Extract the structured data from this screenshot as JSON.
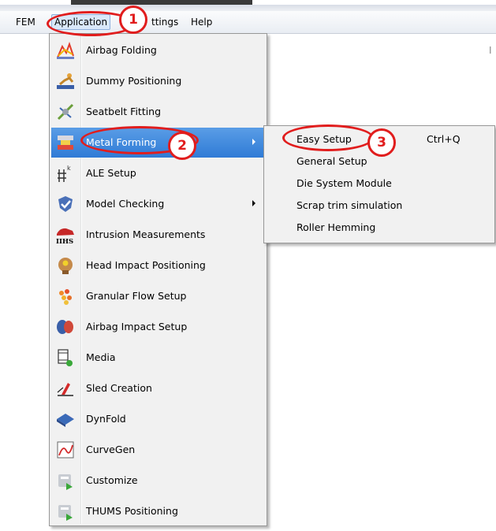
{
  "menubar": {
    "items": [
      {
        "label": "FEM"
      },
      {
        "label": "Application"
      },
      {
        "label": "ttings"
      },
      {
        "label": "Help"
      }
    ]
  },
  "background": {
    "partial_text": "I"
  },
  "app_menu": {
    "items": [
      {
        "label": "Airbag Folding",
        "icon": "airbag-folding-icon"
      },
      {
        "label": "Dummy Positioning",
        "icon": "dummy-positioning-icon"
      },
      {
        "label": "Seatbelt Fitting",
        "icon": "seatbelt-fitting-icon"
      },
      {
        "label": "Metal Forming",
        "icon": "metal-forming-icon",
        "submenu": true,
        "highlighted": true
      },
      {
        "label": "ALE Setup",
        "icon": "ale-setup-icon"
      },
      {
        "label": "Model Checking",
        "icon": "model-checking-icon",
        "submenu": true
      },
      {
        "label": "Intrusion Measurements",
        "icon": "iihs-icon",
        "icon_text": "IIHS"
      },
      {
        "label": "Head Impact Positioning",
        "icon": "head-impact-icon"
      },
      {
        "label": "Granular Flow Setup",
        "icon": "granular-flow-icon"
      },
      {
        "label": "Airbag Impact Setup",
        "icon": "airbag-impact-icon"
      },
      {
        "label": "Media",
        "icon": "media-icon"
      },
      {
        "label": "Sled Creation",
        "icon": "sled-creation-icon"
      },
      {
        "label": "DynFold",
        "icon": "dynfold-icon"
      },
      {
        "label": "CurveGen",
        "icon": "curvegen-icon"
      },
      {
        "label": "Customize",
        "icon": "customize-icon"
      },
      {
        "label": "THUMS Positioning",
        "icon": "thums-positioning-icon"
      }
    ]
  },
  "sub_menu": {
    "items": [
      {
        "label": "Easy Setup",
        "shortcut": "Ctrl+Q"
      },
      {
        "label": "General Setup"
      },
      {
        "label": "Die System Module"
      },
      {
        "label": "Scrap trim simulation"
      },
      {
        "label": "Roller Hemming"
      }
    ]
  },
  "annotations": {
    "step1": "1",
    "step2": "2",
    "step3": "3",
    "color": "#e11d1d"
  },
  "colors": {
    "highlight": "#3a86dd",
    "menu_background": "#f1f1f1"
  }
}
